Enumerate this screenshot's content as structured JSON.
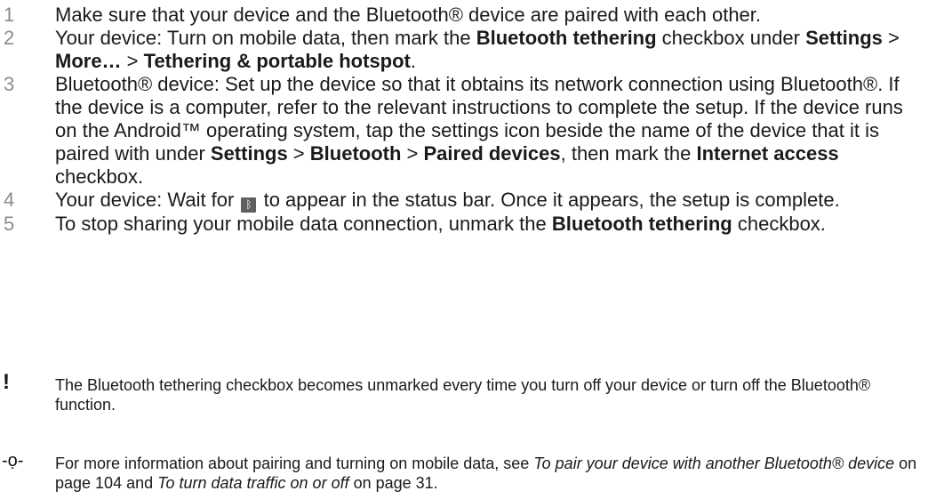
{
  "steps": [
    {
      "num": "1",
      "parts": [
        {
          "t": "Make sure that your device and the Bluetooth® device are paired with each other."
        }
      ]
    },
    {
      "num": "2",
      "parts": [
        {
          "t": "Your device: Turn on mobile data, then mark the "
        },
        {
          "t": "Bluetooth tethering",
          "s": "b"
        },
        {
          "t": " checkbox under "
        },
        {
          "t": "Settings",
          "s": "b"
        },
        {
          "t": " > "
        },
        {
          "t": "More…",
          "s": "b"
        },
        {
          "t": " > "
        },
        {
          "t": "Tethering & portable hotspot",
          "s": "b"
        },
        {
          "t": "."
        }
      ]
    },
    {
      "num": "3",
      "parts": [
        {
          "t": "Bluetooth® device: Set up the device so that it obtains its network connection using Bluetooth®. If the device is a computer, refer to the relevant instructions to complete the setup. If the device runs on the Android™ operating system, tap the settings icon beside the name of the device that it is paired with under "
        },
        {
          "t": "Settings",
          "s": "b"
        },
        {
          "t": " > "
        },
        {
          "t": "Bluetooth",
          "s": "b"
        },
        {
          "t": " > "
        },
        {
          "t": "Paired devices",
          "s": "b"
        },
        {
          "t": ", then mark the "
        },
        {
          "t": "Internet access",
          "s": "b"
        },
        {
          "t": " checkbox."
        }
      ]
    },
    {
      "num": "4",
      "parts": [
        {
          "t": "Your device: Wait for "
        },
        {
          "icon": "bluetooth-status-icon",
          "glyph": "ᛒ"
        },
        {
          "t": " to appear in the status bar. Once it appears, the setup is complete."
        }
      ]
    },
    {
      "num": "5",
      "parts": [
        {
          "t": "To stop sharing your mobile data connection, unmark the "
        },
        {
          "t": "Bluetooth tethering",
          "s": "b"
        },
        {
          "t": " checkbox."
        }
      ]
    }
  ],
  "warning_note": {
    "icon": "exclamation-icon",
    "glyph": "!",
    "parts": [
      {
        "t": "The Bluetooth tethering checkbox becomes unmarked every time you turn off your device or turn off the Bluetooth® function."
      }
    ]
  },
  "tip_note": {
    "icon": "tip-lightbulb-icon",
    "glyph": "-ọ-",
    "parts": [
      {
        "t": "For more information about pairing and turning on mobile data, see "
      },
      {
        "t": "To pair your device with another Bluetooth® device",
        "s": "i"
      },
      {
        "t": " on page 104 and "
      },
      {
        "t": "To turn data traffic on or off",
        "s": "i"
      },
      {
        "t": " on page 31."
      }
    ]
  }
}
